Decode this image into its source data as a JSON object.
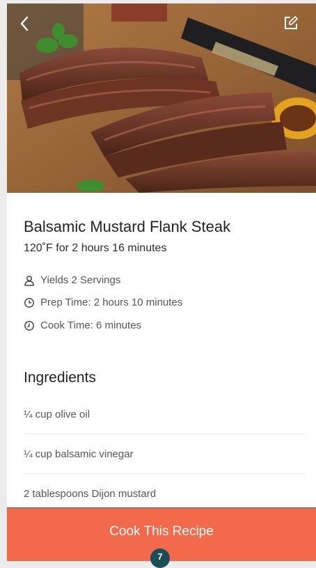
{
  "header": {
    "back_icon": "chevron-left-icon",
    "edit_icon": "edit-icon"
  },
  "recipe": {
    "title": "Balsamic Mustard Flank Steak",
    "subtitle": "120˚F for 2 hours 16 minutes",
    "yields": "Yields 2 Servings",
    "prep_time": "Prep Time: 2 hours 10 minutes",
    "cook_time": "Cook Time: 6 minutes"
  },
  "ingredients": {
    "heading": "Ingredients",
    "items": [
      "¼ cup olive oil",
      "¼ cup balsamic vinegar",
      "2 tablespoons Dijon mustard"
    ]
  },
  "cta": {
    "label": "Cook This Recipe",
    "marker": "7",
    "color": "#f26a4b"
  }
}
